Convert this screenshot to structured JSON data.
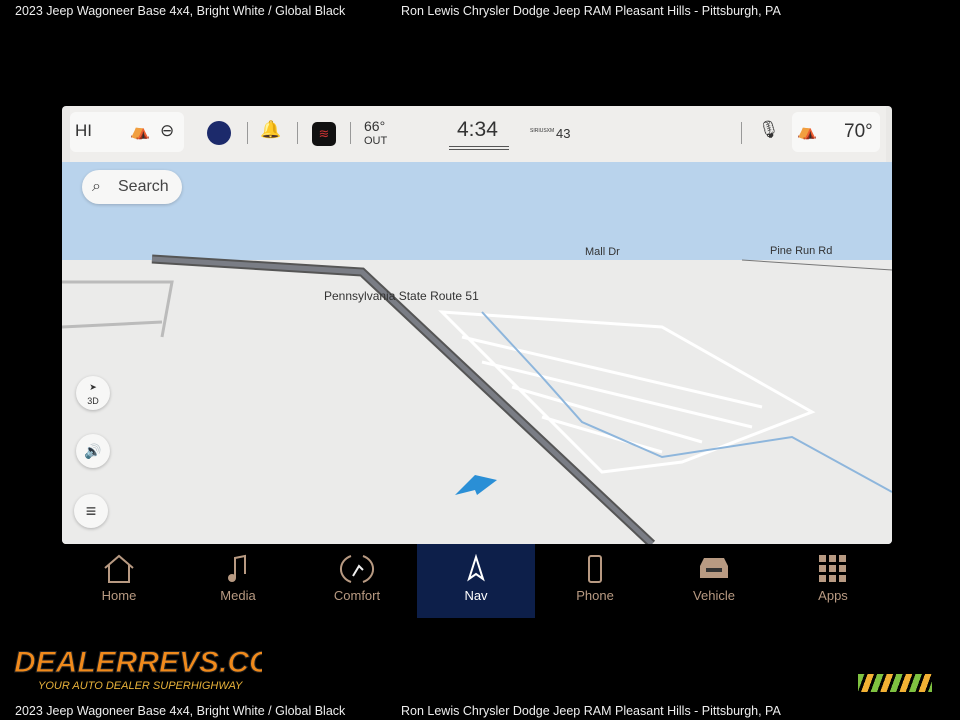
{
  "caption": {
    "left": "2023 Jeep Wagoneer Base 4x4,  Bright White / Global Black",
    "right": "Ron Lewis Chrysler Dodge Jeep RAM Pleasant Hills - Pittsburgh, PA"
  },
  "status": {
    "fan": "HI",
    "outside_temp": "66°",
    "outside_label": "OUT",
    "time": "4:34",
    "sxm_label": "SIRIUSXM",
    "channel": "43",
    "cabin_temp": "70°"
  },
  "map": {
    "search_label": "Search",
    "view_mode": "3D",
    "streets": [
      "Mall Dr",
      "Pine Run Rd",
      "Pennsylvania State Route 51"
    ]
  },
  "nav": [
    {
      "label": "Home",
      "icon": "home-icon"
    },
    {
      "label": "Media",
      "icon": "music-note-icon"
    },
    {
      "label": "Comfort",
      "icon": "seat-comfort-icon"
    },
    {
      "label": "Nav",
      "icon": "nav-arrow-icon",
      "active": true
    },
    {
      "label": "Phone",
      "icon": "phone-icon"
    },
    {
      "label": "Vehicle",
      "icon": "vehicle-icon"
    },
    {
      "label": "Apps",
      "icon": "apps-grid-icon"
    }
  ],
  "watermark": {
    "brand": "DealerRevs.com",
    "tagline": "Your Auto Dealer SuperHighway"
  },
  "colors": {
    "accent": "#0d1f4a",
    "nav_inactive": "#b89a82",
    "water": "#b9d3ec",
    "route_marker": "#2a8fd6"
  }
}
